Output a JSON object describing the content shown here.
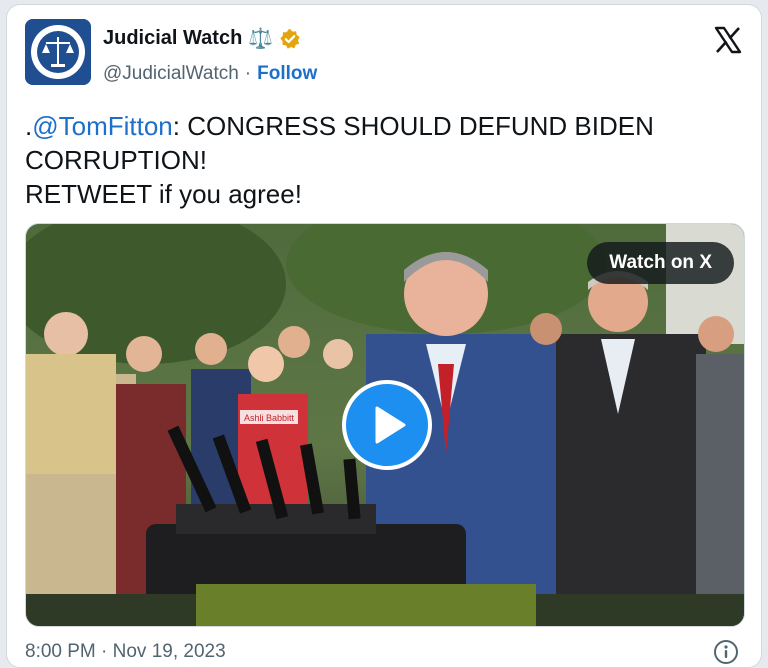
{
  "account": {
    "display_name": "Judicial Watch",
    "emoji": "⚖️",
    "handle": "@JudicialWatch",
    "separator": "·",
    "follow_label": "Follow"
  },
  "tweet": {
    "prefix": ".",
    "mention": "@TomFitton",
    "line1_rest": ": CONGRESS SHOULD DEFUND BIDEN",
    "line2": "CORRUPTION!",
    "line3": "RETWEET if you agree!"
  },
  "media": {
    "watch_label": "Watch on X",
    "sign_text": "Ashli Babbitt"
  },
  "footer": {
    "timestamp": "8:00 PM · Nov 19, 2023"
  },
  "icons": {
    "brand": "x-logo-icon",
    "verified": "verified-badge-icon",
    "play": "play-icon",
    "info": "info-icon"
  },
  "colors": {
    "link": "#1d6fc9",
    "play_button": "#1d8ff0",
    "verified_gold": "#e2a40f"
  }
}
